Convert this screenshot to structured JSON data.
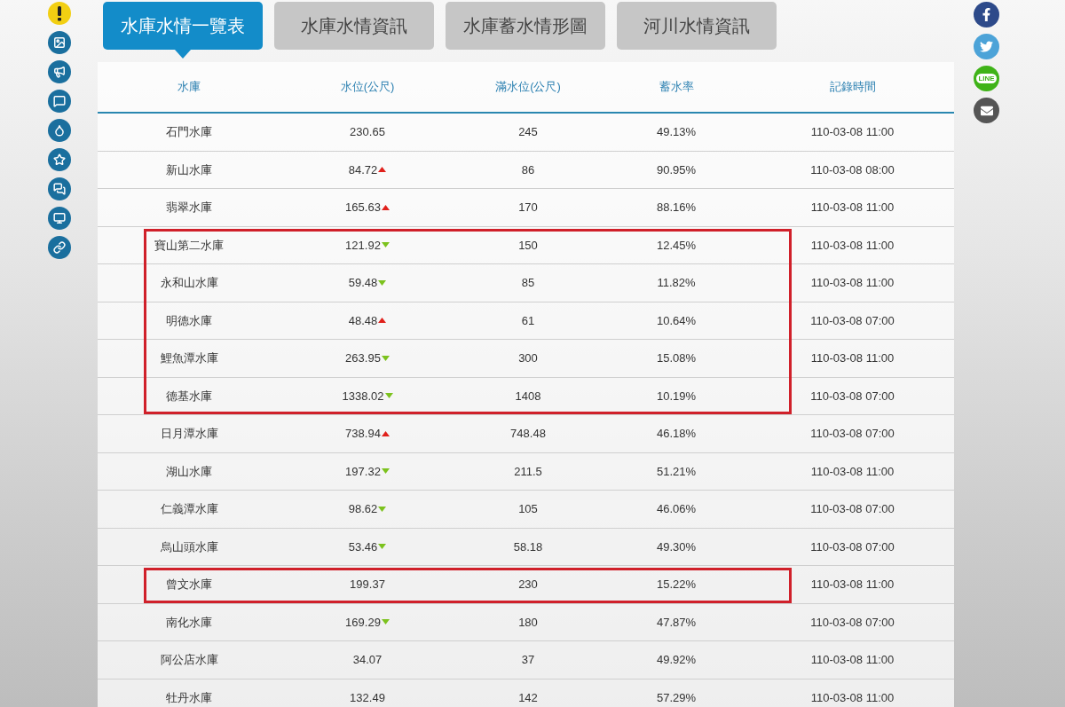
{
  "tabs": [
    {
      "label": "水庫水情一覽表",
      "selected": true
    },
    {
      "label": "水庫水情資訊",
      "selected": false
    },
    {
      "label": "水庫蓄水情形圖",
      "selected": false
    },
    {
      "label": "河川水情資訊",
      "selected": false
    }
  ],
  "table": {
    "columns": [
      "水庫",
      "水位(公尺)",
      "滿水位(公尺)",
      "蓄水率",
      "記錄時間"
    ],
    "rows": [
      {
        "name": "石門水庫",
        "level": "230.65",
        "kind": "none",
        "full": "245",
        "rate": "49.13%",
        "time": "110-03-08 11:00",
        "highlighted": false
      },
      {
        "name": "新山水庫",
        "level": "84.72",
        "kind": "up",
        "full": "86",
        "rate": "90.95%",
        "time": "110-03-08 08:00",
        "highlighted": false
      },
      {
        "name": "翡翠水庫",
        "level": "165.63",
        "kind": "up",
        "full": "170",
        "rate": "88.16%",
        "time": "110-03-08 11:00",
        "highlighted": false
      },
      {
        "name": "寶山第二水庫",
        "level": "121.92",
        "kind": "down",
        "full": "150",
        "rate": "12.45%",
        "time": "110-03-08 11:00",
        "highlighted": true
      },
      {
        "name": "永和山水庫",
        "level": "59.48",
        "kind": "down",
        "full": "85",
        "rate": "11.82%",
        "time": "110-03-08 11:00",
        "highlighted": true
      },
      {
        "name": "明德水庫",
        "level": "48.48",
        "kind": "up",
        "full": "61",
        "rate": "10.64%",
        "time": "110-03-08 07:00",
        "highlighted": true
      },
      {
        "name": "鯉魚潭水庫",
        "level": "263.95",
        "kind": "down",
        "full": "300",
        "rate": "15.08%",
        "time": "110-03-08 11:00",
        "highlighted": true
      },
      {
        "name": "德基水庫",
        "level": "1338.02",
        "kind": "down",
        "full": "1408",
        "rate": "10.19%",
        "time": "110-03-08 07:00",
        "highlighted": true
      },
      {
        "name": "日月潭水庫",
        "level": "738.94",
        "kind": "up",
        "full": "748.48",
        "rate": "46.18%",
        "time": "110-03-08 07:00",
        "highlighted": false
      },
      {
        "name": "湖山水庫",
        "level": "197.32",
        "kind": "down",
        "full": "211.5",
        "rate": "51.21%",
        "time": "110-03-08 11:00",
        "highlighted": false
      },
      {
        "name": "仁義潭水庫",
        "level": "98.62",
        "kind": "down",
        "full": "105",
        "rate": "46.06%",
        "time": "110-03-08 07:00",
        "highlighted": false
      },
      {
        "name": "烏山頭水庫",
        "level": "53.46",
        "kind": "down",
        "full": "58.18",
        "rate": "49.30%",
        "time": "110-03-08 07:00",
        "highlighted": false
      },
      {
        "name": "曾文水庫",
        "level": "199.37",
        "kind": "none",
        "full": "230",
        "rate": "15.22%",
        "time": "110-03-08 11:00",
        "highlighted": true
      },
      {
        "name": "南化水庫",
        "level": "169.29",
        "kind": "down",
        "full": "180",
        "rate": "47.87%",
        "time": "110-03-08 07:00",
        "highlighted": false
      },
      {
        "name": "阿公店水庫",
        "level": "34.07",
        "kind": "none",
        "full": "37",
        "rate": "49.92%",
        "time": "110-03-08 11:00",
        "highlighted": false
      },
      {
        "name": "牡丹水庫",
        "level": "132.49",
        "kind": "none",
        "full": "142",
        "rate": "57.29%",
        "time": "110-03-08 11:00",
        "highlighted": false
      }
    ]
  },
  "share": {
    "line_label": "LINE"
  }
}
